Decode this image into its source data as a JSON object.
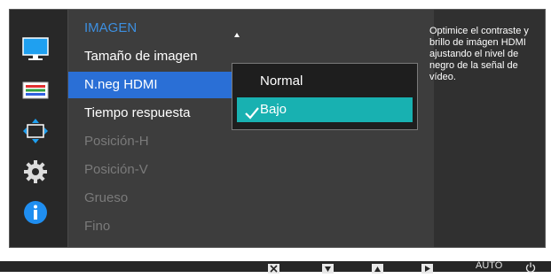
{
  "menu": {
    "title": "IMAGEN",
    "items": [
      {
        "label": "Tamaño de imagen",
        "state": "normal"
      },
      {
        "label": "N.neg HDMI",
        "state": "selected"
      },
      {
        "label": "Tiempo respuesta",
        "state": "normal"
      },
      {
        "label": "Posición-H",
        "state": "disabled"
      },
      {
        "label": "Posición-V",
        "state": "disabled"
      },
      {
        "label": "Grueso",
        "state": "disabled"
      },
      {
        "label": "Fino",
        "state": "disabled"
      }
    ]
  },
  "submenu": {
    "options": [
      {
        "label": "Normal",
        "checked": false
      },
      {
        "label": "Bajo",
        "checked": true
      }
    ]
  },
  "help": {
    "text": "Optimice el contraste y brillo de imágen HDMI ajustando el nivel de negro de la señal de vídeo."
  },
  "sidebar": {
    "icons": [
      "monitor-icon",
      "color-bars-icon",
      "size-position-icon",
      "gear-icon",
      "info-icon"
    ]
  },
  "bottom_bar": {
    "buttons": [
      "close-icon",
      "down-icon",
      "up-icon",
      "enter-icon"
    ],
    "auto_label": "AUTO",
    "power_icon": "power-icon"
  },
  "colors": {
    "selected_item": "#2a6fd6",
    "selected_option": "#18b1b1",
    "title": "#3d8fe0"
  }
}
